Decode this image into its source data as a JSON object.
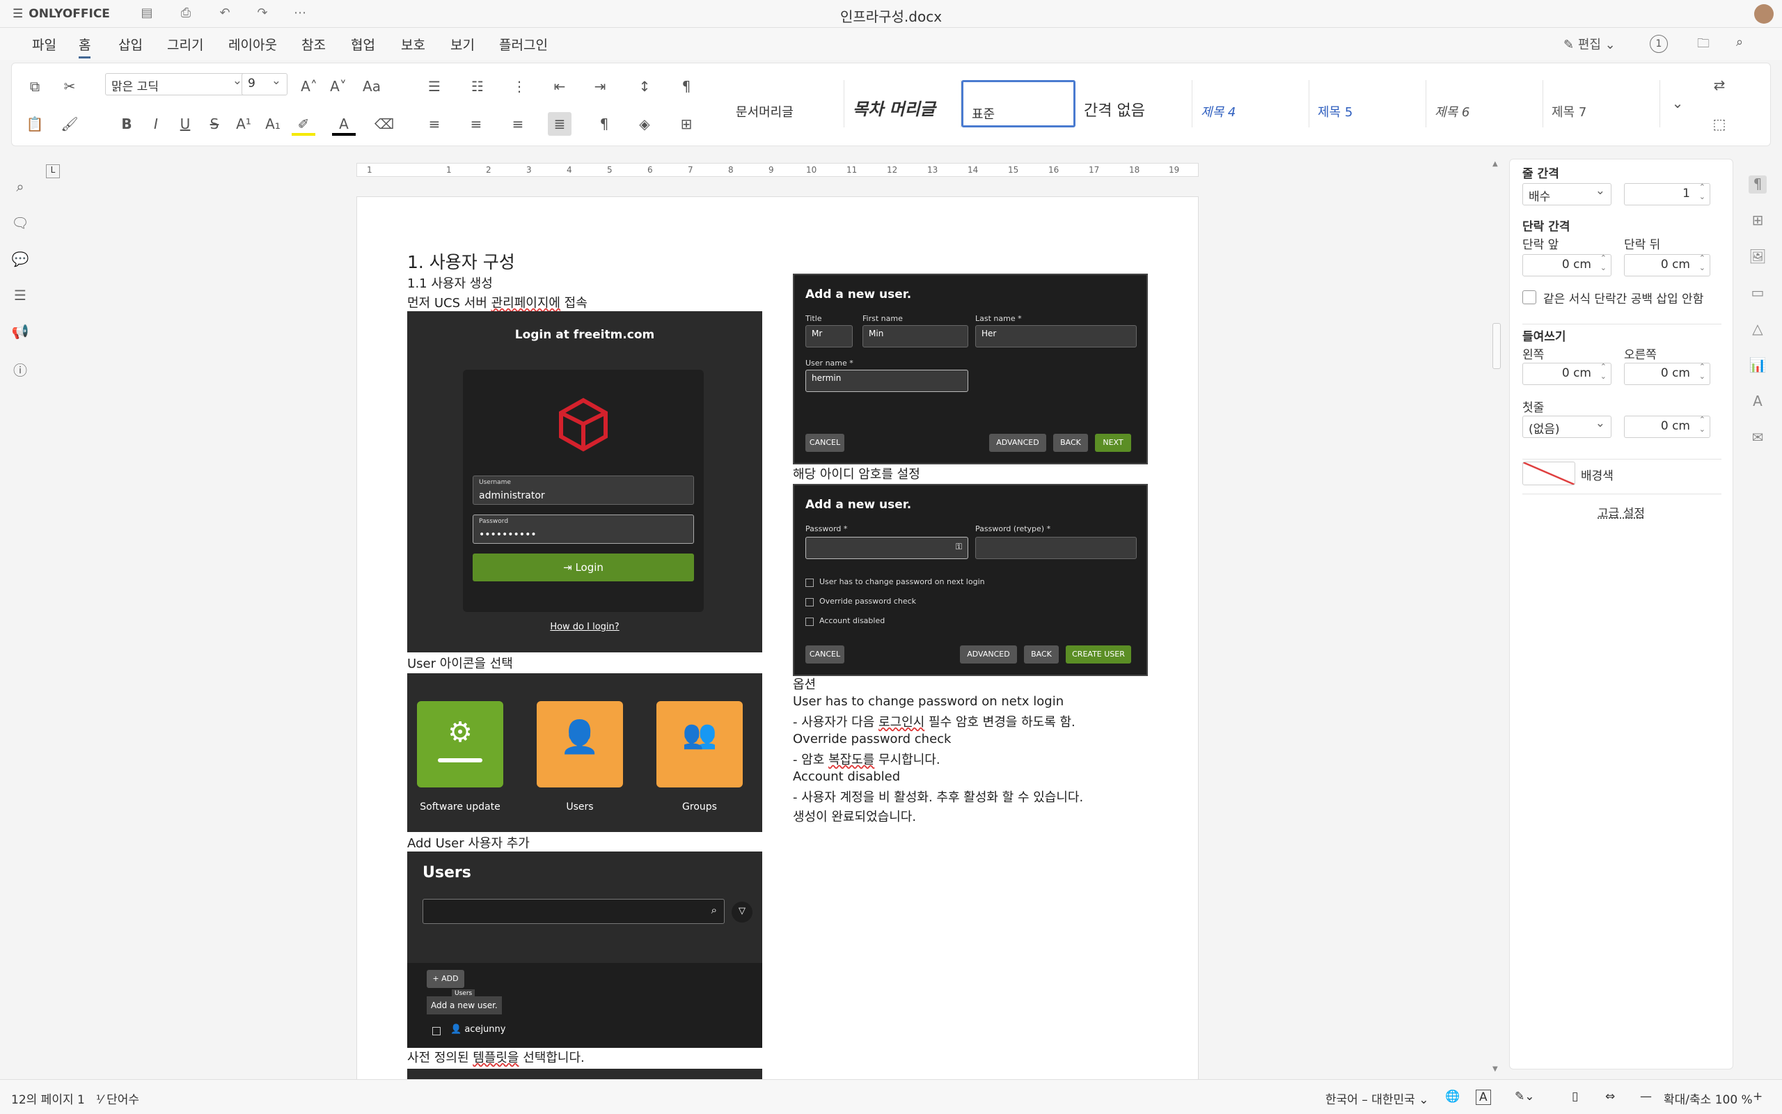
{
  "app": {
    "name": "ONLYOFFICE",
    "doc_title": "인프라구성.docx"
  },
  "menu": {
    "items": [
      "파일",
      "홈",
      "삽입",
      "그리기",
      "레이아웃",
      "참조",
      "협업",
      "보호",
      "보기",
      "플러그인"
    ],
    "edit_label": "편집",
    "users_count": "1"
  },
  "toolbar": {
    "font_name": "맑은 고딕",
    "font_size": "9",
    "styles": [
      "문서머리글",
      "목차 머리글",
      "표준",
      "간격 없음",
      "제목 4",
      "제목 5",
      "제목 6",
      "제목 7"
    ]
  },
  "ruler": {
    "ticks": [
      "1",
      "1",
      "2",
      "3",
      "4",
      "5",
      "6",
      "7",
      "8",
      "9",
      "10",
      "11",
      "12",
      "13",
      "14",
      "15",
      "16",
      "17",
      "18",
      "19"
    ]
  },
  "doc": {
    "h1": "1. 사용자 구성",
    "h2": "1.1 사용자 생성",
    "p1_a": "먼저 UCS 서버 ",
    "p1_b": "관리페이지에",
    "p1_c": " 접속",
    "login": {
      "title": "Login at freeitm.com",
      "username_label": "Username",
      "username": "administrator",
      "password_label": "Password",
      "password": "••••••••••",
      "login_btn": "Login",
      "help": "How do I login?"
    },
    "cap_user_icon": "User 아이콘을 선택",
    "tiles": [
      "Software update",
      "Users",
      "Groups"
    ],
    "cap_add_user": "Add User 사용자 추가",
    "users": {
      "title": "Users",
      "add": "+ ADD",
      "tooltip": "Users",
      "tooltip2": "Add a new user.",
      "row": "acejunny"
    },
    "cap_template_a": "사전 정의된 ",
    "cap_template_b": "템플릿을",
    "cap_template_c": " 선택합니다.",
    "adduser1": {
      "title": "Add a new user.",
      "title_label": "Title",
      "title_val": "Mr",
      "first_label": "First name",
      "first_val": "Min",
      "last_label": "Last name *",
      "last_val": "Her",
      "user_label": "User name *",
      "user_val": "hermin",
      "cancel": "CANCEL",
      "advanced": "ADVANCED",
      "back": "BACK",
      "next": "NEXT"
    },
    "cap_pw": "해당 아이디 암호를 설정",
    "adduser2": {
      "title": "Add a new user.",
      "pw_label": "Password *",
      "pw2_label": "Password (retype) *",
      "cb1": "User has to change password on next login",
      "cb2": "Override password check",
      "cb3": "Account disabled",
      "cancel": "CANCEL",
      "advanced": "ADVANCED",
      "back": "BACK",
      "create": "CREATE USER"
    },
    "opt_title": "옵션",
    "opt1": "User has to change password on netx login",
    "opt1_desc_a": "  - 사용자가 다음 ",
    "opt1_desc_b": "로그인시",
    "opt1_desc_c": " 필수 암호 변경을 하도록 함.",
    "opt2": "Override password check",
    "opt2_desc_a": "  - 암호 ",
    "opt2_desc_b": "복잡도를",
    "opt2_desc_c": " 무시합니다.",
    "opt3": "Account disabled",
    "opt3_desc": "  - 사용자 계정을 비 활성화. 추후 활성화 할 수 있습니다.",
    "done": "생성이 완료되었습니다."
  },
  "panel": {
    "line_spacing": "줄 간격",
    "line_mode": "배수",
    "line_val": "1",
    "para_spacing": "단락 간격",
    "before": "단락 앞",
    "after": "단락 뒤",
    "before_val": "0 cm",
    "after_val": "0 cm",
    "no_space": "같은 서식 단락간 공백 삽입 안함",
    "indent": "들여쓰기",
    "left": "왼쪽",
    "right": "오른쪽",
    "left_val": "0 cm",
    "right_val": "0 cm",
    "first_line": "첫줄",
    "first_mode": "(없음)",
    "first_val": "0 cm",
    "bg_color": "배경색",
    "advanced": "고급 설정"
  },
  "status": {
    "page": "12의 페이지 1",
    "words": "단어수",
    "lang": "한국어 – 대한민국",
    "zoom": "확대/축소 100 %"
  }
}
